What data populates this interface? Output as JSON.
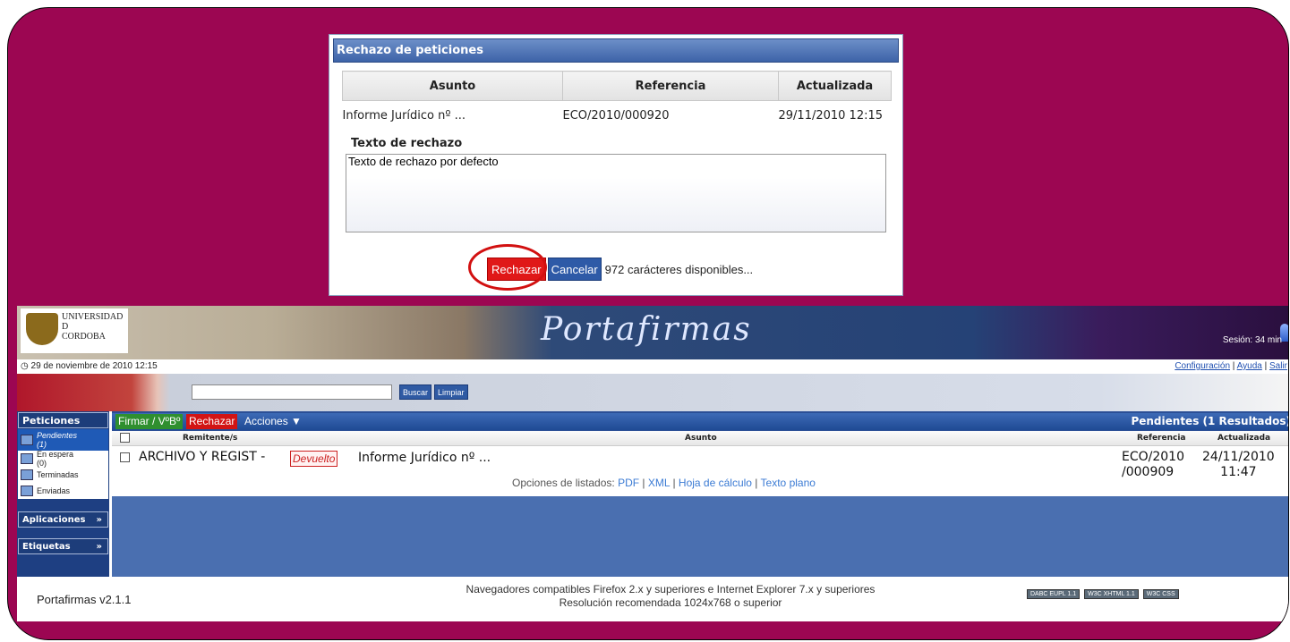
{
  "dialog": {
    "title": "Rechazo de peticiones",
    "columns": [
      "Asunto",
      "Referencia",
      "Actualizada"
    ],
    "row": {
      "asunto": "Informe Jurídico nº ...",
      "referencia": "ECO/2010/000920",
      "actualizada": "29/11/2010 12:15"
    },
    "text_label": "Texto de rechazo",
    "text_value": "Texto de rechazo por defecto",
    "reject_label": "Rechazar",
    "cancel_label": "Cancelar",
    "chars_left": "972 carácteres disponibles..."
  },
  "app": {
    "logo_lines": [
      "UNIVERSIDAD",
      "D",
      "CORDOBA"
    ],
    "product": "Portafirmas",
    "session": "Sesión: 34 min",
    "date": "29 de noviembre de 2010 12:15",
    "links": [
      "Configuración",
      "Ayuda",
      "Salir"
    ],
    "search_buttons": [
      "Buscar",
      "Limpiar"
    ],
    "sidebar": {
      "heading": "Peticiones",
      "items": [
        {
          "label": "Pendientes",
          "count": "(1)"
        },
        {
          "label": "En espera",
          "count": "(0)"
        },
        {
          "label": "Terminadas",
          "count": ""
        },
        {
          "label": "Enviadas",
          "count": ""
        }
      ],
      "sections": [
        "Aplicaciones",
        "Etiquetas"
      ]
    },
    "toolbar": {
      "sign": "Firmar / VºBº",
      "reject": "Rechazar",
      "actions": "Acciones ▼",
      "title": "Pendientes (1 Resultados)"
    },
    "grid": {
      "columns": [
        "Remitente/s",
        "Asunto",
        "Referencia",
        "Actualizada"
      ],
      "row": {
        "sender": "ARCHIVO Y REGIST -",
        "badge": "Devuelto",
        "subject": "Informe Jurídico nº ...",
        "ref_line1": "ECO/2010",
        "ref_line2": "/000909",
        "date_line1": "24/11/2010",
        "date_line2": "11:47"
      },
      "options_label": "Opciones de listados:",
      "options": [
        "PDF",
        "XML",
        "Hoja de cálculo",
        "Texto plano"
      ]
    },
    "footer": {
      "version": "Portafirmas v2.1.1",
      "browsers": "Navegadores compatibles Firefox 2.x y superiores e Internet Explorer 7.x y superiores",
      "resolution": "Resolución recomendada 1024x768 o superior",
      "badges": [
        "DABC EUPL 1.1",
        "W3C XHTML 1.1",
        "W3C CSS"
      ]
    }
  }
}
